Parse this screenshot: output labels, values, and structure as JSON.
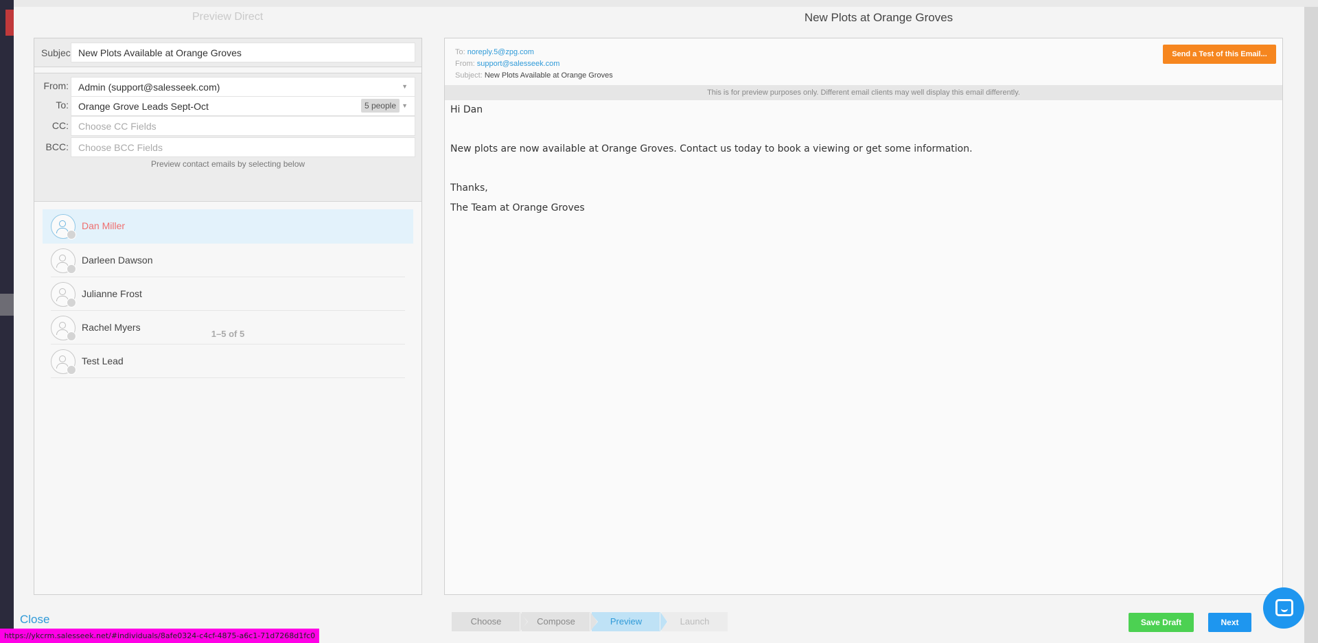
{
  "header": {
    "left_title": "Preview Direct",
    "title": "New Plots at Orange Groves"
  },
  "form": {
    "subject_label": "Subject:",
    "subject_value": "New Plots Available at Orange Groves",
    "from_label": "From:",
    "from_value": "Admin (support@salesseek.com)",
    "to_label": "To:",
    "to_value": "Orange Grove Leads Sept-Oct",
    "to_badge": "5 people",
    "cc_label": "CC:",
    "cc_placeholder": "Choose CC Fields",
    "bcc_label": "BCC:",
    "bcc_placeholder": "Choose BCC Fields",
    "preview_hint": "Preview contact emails by selecting below"
  },
  "contacts": {
    "items": [
      {
        "name": "Dan Miller"
      },
      {
        "name": "Darleen Dawson"
      },
      {
        "name": "Julianne Frost"
      },
      {
        "name": "Rachel Myers"
      },
      {
        "name": "Test Lead"
      }
    ],
    "pagination": "1–5 of 5"
  },
  "preview": {
    "to_label": "To:",
    "to_value": "noreply.5@zpg.com",
    "from_label": "From:",
    "from_value": "support@salesseek.com",
    "subject_label": "Subject:",
    "subject_value": "New Plots Available at Orange Groves",
    "test_button": "Send a Test of this Email...",
    "notice": "This is for preview purposes only. Different email clients may well display this email differently.",
    "body": {
      "greeting": "Hi Dan",
      "paragraph": "New plots are now available at Orange Groves. Contact us today to book a viewing or get some information.",
      "thanks": "Thanks,",
      "signature": "The Team at Orange Groves"
    }
  },
  "footer": {
    "close": "Close",
    "steps": [
      "Choose",
      "Compose",
      "Preview",
      "Launch"
    ],
    "save_draft": "Save Draft",
    "next": "Next"
  },
  "status_bar": {
    "url": "https://ykcrm.salesseek.net/#individuals/8afe0324-c4cf-4875-a6c1-71d7268d1fc0"
  },
  "colors": {
    "accent": "#1e96ef",
    "orange": "#f6861f",
    "green": "#4cd152",
    "selected_name": "#ef6f6f"
  }
}
